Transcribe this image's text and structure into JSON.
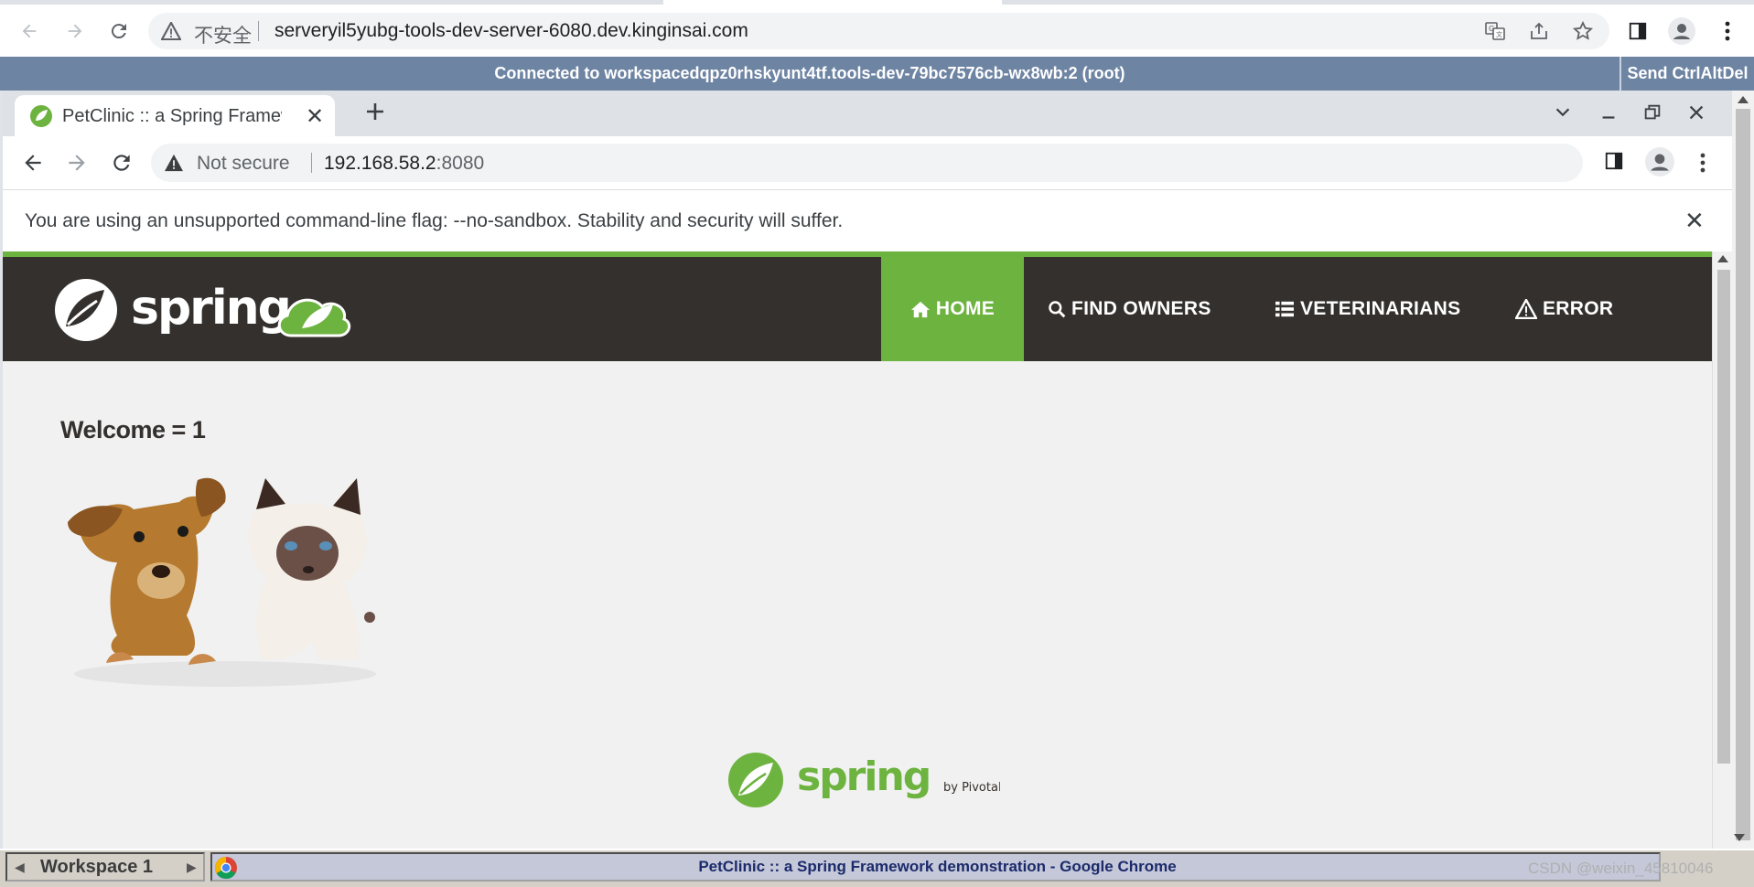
{
  "outer_browser": {
    "security_label": "不安全",
    "url": "serveryil5yubg-tools-dev-server-6080.dev.kinginsai.com"
  },
  "vnc": {
    "status": "Connected to workspacedqpz0rhskyunt4tf.tools-dev-79bc7576cb-wx8wb:2 (root)",
    "send_cad_label": "Send CtrlAltDel"
  },
  "inner_browser": {
    "tab_title": "PetClinic :: a Spring Framework demonstration",
    "security_label": "Not secure",
    "url_host": "192.168.58.2",
    "url_port": ":8080",
    "infobar_message": "You are using an unsupported command-line flag: --no-sandbox. Stability and security will suffer."
  },
  "site": {
    "logo_text": "spring",
    "nav": [
      {
        "label": "HOME",
        "icon": "home-icon",
        "active": true
      },
      {
        "label": "FIND OWNERS",
        "icon": "search-icon",
        "active": false
      },
      {
        "label": "VETERINARIANS",
        "icon": "list-icon",
        "active": false
      },
      {
        "label": "ERROR",
        "icon": "warning-icon",
        "active": false
      }
    ],
    "welcome": "Welcome = 1",
    "footer_logo_text": "spring",
    "footer_by": "by Pivotal."
  },
  "taskbar": {
    "workspace_label": "Workspace 1",
    "window_title": "PetClinic :: a Spring Framework demonstration - Google Chrome",
    "watermark": "CSDN @weixin_45810046"
  },
  "colors": {
    "spring_green": "#6db33f",
    "navbar_dark": "#34302d",
    "vnc_bar": "#6e84a3"
  }
}
